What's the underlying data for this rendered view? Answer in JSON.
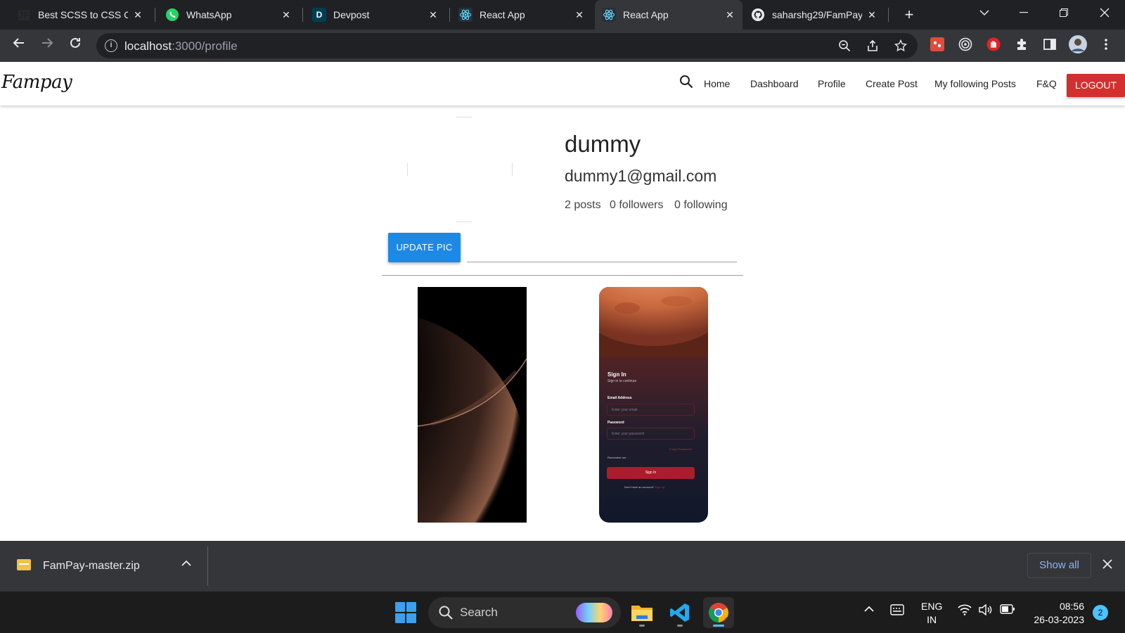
{
  "browser": {
    "tabs": [
      {
        "title": "Best SCSS to CSS C",
        "icon": "jf-favicon"
      },
      {
        "title": "WhatsApp",
        "icon": "whatsapp-icon"
      },
      {
        "title": "Devpost",
        "icon": "devpost-icon"
      },
      {
        "title": "React App",
        "icon": "react-icon"
      },
      {
        "title": "React App",
        "icon": "react-icon",
        "active": true
      },
      {
        "title": "saharshg29/FamPay",
        "icon": "github-icon"
      }
    ],
    "favicon_text": {
      "jf": "JF",
      "devpost": "D"
    },
    "url_host": "localhost",
    "url_path": ":3000/profile"
  },
  "navbar": {
    "brand": "Fampay",
    "links": [
      "Home",
      "Dashboard",
      "Profile",
      "Create Post",
      "My following Posts",
      "F&Q"
    ],
    "logout_label": "LOGOUT"
  },
  "profile": {
    "name": "dummy",
    "email": "dummy1@gmail.com",
    "posts": "2 posts",
    "followers": "0 followers",
    "following": "0 following",
    "update_pic_label": "UPDATE PIC"
  },
  "mockup": {
    "title": "Sign In",
    "subtitle": "Sign in to continue",
    "email_label": "Email Address",
    "email_placeholder": "Enter your email",
    "password_label": "Password",
    "password_placeholder": "Enter your password",
    "forgot": "Forgot Password?",
    "remember": "Remember me",
    "signin_btn": "Sign In",
    "footer": "Don't have an account?",
    "footer_link": "Sign Up"
  },
  "download": {
    "filename": "FamPay-master.zip",
    "show_all": "Show all"
  },
  "taskbar": {
    "search_label": "Search",
    "lang_top": "ENG",
    "lang_bottom": "IN",
    "time": "08:56",
    "date": "26-03-2023",
    "notification_count": "2"
  },
  "colors": {
    "logout": "#d32f2f",
    "update_pic": "#1e88e5",
    "chrome_dark": "#202124",
    "chrome_toolbar": "#35363a",
    "link_blue": "#8ab4f8"
  }
}
